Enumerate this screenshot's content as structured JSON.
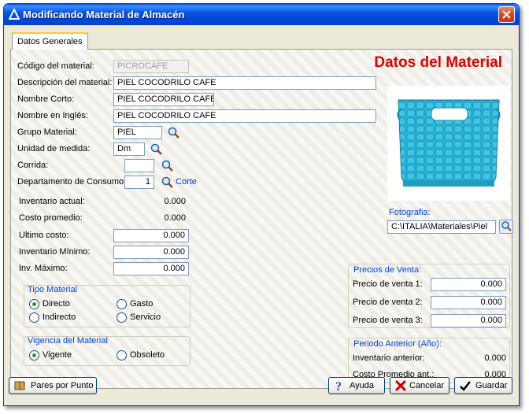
{
  "window": {
    "title": "Modificando Material  de Almacén"
  },
  "tabs": [
    {
      "label": "Datos Generales"
    }
  ],
  "banner": "Datos del Material",
  "fields": {
    "codigo": {
      "label": "Código del material:",
      "value": "PICROCAFE"
    },
    "descripcion": {
      "label": "Descripción del material:",
      "value": "PIEL COCODRILO CAFE"
    },
    "nombre_corto": {
      "label": "Nombre Corto:",
      "value": "PIEL COCODRILO CAFE"
    },
    "nombre_ingles": {
      "label": "Nombre en Inglés:",
      "value": "PIEL COCODRILO CAFE"
    },
    "grupo": {
      "label": "Grupo Material:",
      "value": "PIEL"
    },
    "unidad": {
      "label": "Unidad de medida:",
      "value": "Dm"
    },
    "corrida": {
      "label": "Corrida:",
      "value": ""
    },
    "departamento": {
      "label": "Departamento de Consumo:",
      "value": "1",
      "link": "Corte"
    }
  },
  "inventory": {
    "inventario_actual": {
      "label": "Inventario actual:",
      "value": "0.000"
    },
    "costo_promedio": {
      "label": "Costo promedio:",
      "value": "0.000"
    },
    "ultimo_costo": {
      "label": "Ultimo costo:",
      "value": "0.000"
    },
    "inventario_minimo": {
      "label": "Inventario Mínimo:",
      "value": "0.000"
    },
    "inv_maximo": {
      "label": "Inv. Máximo:",
      "value": "0.000"
    }
  },
  "tipo_material": {
    "title": "Tipo Material",
    "options": [
      "Directo",
      "Gasto",
      "Indirecto",
      "Servicio"
    ],
    "selected": "Directo"
  },
  "vigencia": {
    "title": "Vigencia del Material",
    "options": [
      "Vigente",
      "Obsoleto"
    ],
    "selected": "Vigente"
  },
  "fotografia": {
    "label": "Fotografia:",
    "path": "C:\\ITALIA\\Materiales\\Piel"
  },
  "precios": {
    "title": "Precios de Venta:",
    "items": [
      {
        "label": "Precio de venta 1:",
        "value": "0.000"
      },
      {
        "label": "Precio de venta 2:",
        "value": "0.000"
      },
      {
        "label": "Precio de venta 3:",
        "value": "0.000"
      }
    ]
  },
  "periodo": {
    "title": "Periodo Anterior (Año):",
    "items": [
      {
        "label": "Inventario anterior:",
        "value": "0.000"
      },
      {
        "label": "Costo Promedio ant.:",
        "value": "0.000"
      }
    ]
  },
  "buttons": {
    "pares": "Pares por Punto",
    "ayuda": "Ayuda",
    "cancelar": "Cancelar",
    "guardar": "Guardar"
  },
  "colors": {
    "banner": "#e00000",
    "group_title": "#0046d5",
    "bag": "#2bb6d8"
  }
}
